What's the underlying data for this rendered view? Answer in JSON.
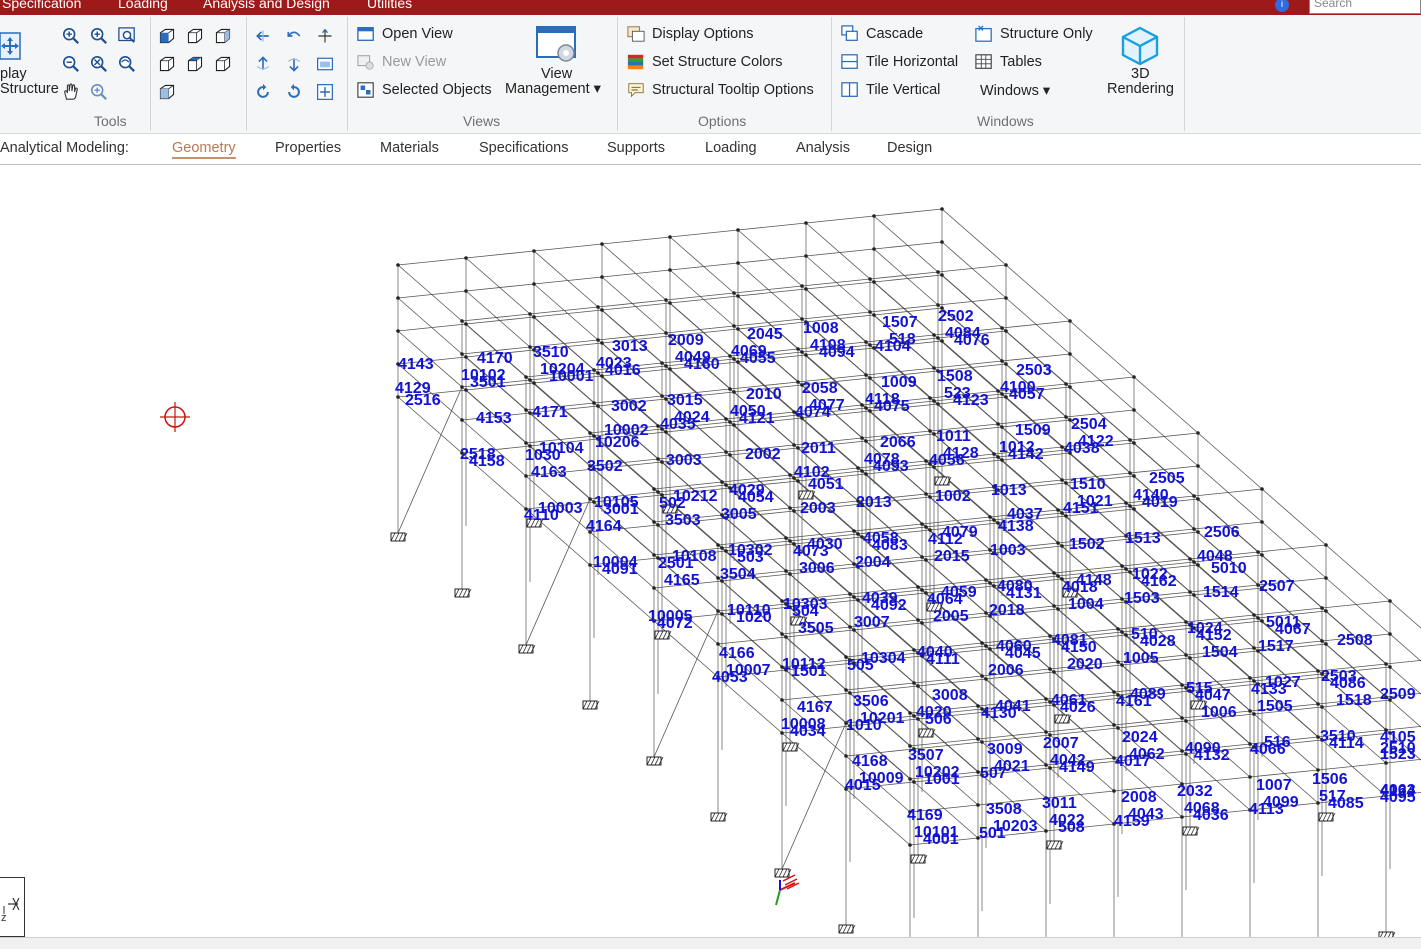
{
  "menu": {
    "items": [
      "Specification",
      "Loading",
      "Analysis and Design",
      "Utilities"
    ],
    "search_placeholder": "Search",
    "info_label": "i"
  },
  "ribbon": {
    "display_structure": {
      "line1": "play",
      "line2": "Structure"
    },
    "groups": {
      "tools": "Tools",
      "views": "Views",
      "options": "Options",
      "windows": "Windows"
    },
    "views": {
      "open_view": "Open View",
      "new_view": "New View",
      "selected_objects": "Selected Objects",
      "view_management_1": "View",
      "view_management_2": "Management ▾"
    },
    "options": {
      "display_options": "Display Options",
      "set_structure_colors": "Set Structure Colors",
      "structural_tooltip_options": "Structural Tooltip Options"
    },
    "windows": {
      "cascade": "Cascade",
      "tile_horizontal": "Tile Horizontal",
      "tile_vertical": "Tile Vertical",
      "structure_only": "Structure Only",
      "tables": "Tables",
      "windows_dropdown": "Windows ▾",
      "rendering_1": "3D",
      "rendering_2": "Rendering"
    }
  },
  "subtabs": {
    "label": "Analytical Modeling:",
    "items": [
      "Geometry",
      "Properties",
      "Materials",
      "Specifications",
      "Supports",
      "Loading",
      "Analysis",
      "Design"
    ],
    "active": "Geometry"
  },
  "model": {
    "colors": {
      "label": "#1212d6",
      "member": "#555555",
      "node": "#222222",
      "cursor": "#cc1111"
    },
    "labels": [
      "4129",
      "4158",
      "4110",
      "4091",
      "4072",
      "4053",
      "4034",
      "4015",
      "4001",
      "3501",
      "1030",
      "3001",
      "2501",
      "1020",
      "1501",
      "1010",
      "1001",
      "501",
      "10001",
      "10002",
      "502",
      "503",
      "504",
      "505",
      "506",
      "507",
      "508",
      "4016",
      "4035",
      "4054",
      "4073",
      "4092",
      "4111",
      "4130",
      "4149",
      "4159",
      "4160",
      "4121",
      "4102",
      "4083",
      "4064",
      "4045",
      "4026",
      "4017",
      "4036",
      "4055",
      "4074",
      "4093",
      "4112",
      "4131",
      "4150",
      "4161",
      "4132",
      "4113",
      "4094",
      "4075",
      "4056",
      "4037",
      "4018",
      "4028",
      "4047",
      "4066",
      "4085",
      "4104",
      "4123",
      "4142",
      "4151",
      "4162",
      "4152",
      "4133",
      "4114",
      "4095",
      "4076",
      "4057",
      "4038",
      "4019",
      "4048",
      "4067",
      "4086",
      "4105",
      "4124",
      "4143",
      "4153",
      "4163",
      "4164",
      "4165",
      "4166",
      "4167",
      "4168",
      "4169",
      "4170",
      "4171",
      "3502",
      "3503",
      "3504",
      "3505",
      "3506",
      "3507",
      "3508",
      "3510",
      "3002",
      "3003",
      "3005",
      "3006",
      "3007",
      "3008",
      "3009",
      "3011",
      "3013",
      "3015",
      "2002",
      "2003",
      "2004",
      "2005",
      "2006",
      "2007",
      "2008",
      "2009",
      "2010",
      "2011",
      "2013",
      "2015",
      "2018",
      "2020",
      "2024",
      "2032",
      "2045",
      "2058",
      "2066",
      "1002",
      "1003",
      "1004",
      "1005",
      "1006",
      "1007",
      "1008",
      "1009",
      "1011",
      "1013",
      "1502",
      "1503",
      "1504",
      "1505",
      "1506",
      "1507",
      "1508",
      "1509",
      "1510",
      "1513",
      "1514",
      "1517",
      "1518",
      "1523",
      "2502",
      "2503",
      "2504",
      "2505",
      "2506",
      "2507",
      "2508",
      "2509",
      "2510",
      "2516",
      "2518",
      "10003",
      "10004",
      "10005",
      "10007",
      "10008",
      "10009",
      "10101",
      "10102",
      "10104",
      "10105",
      "10108",
      "10110",
      "10112",
      "10201",
      "10202",
      "10203",
      "10204",
      "10206",
      "10212",
      "10302",
      "10303",
      "10304",
      "4020",
      "4021",
      "4022",
      "4023",
      "4024",
      "4029",
      "4030",
      "4039",
      "4040",
      "4041",
      "4042",
      "4043",
      "4049",
      "4050",
      "4051",
      "4058",
      "4059",
      "4060",
      "4061",
      "4062",
      "4068",
      "4069",
      "4077",
      "4078",
      "4079",
      "4080",
      "4081",
      "4089",
      "4090",
      "4099",
      "4108",
      "4118",
      "4128",
      "4138",
      "4148",
      "510",
      "515",
      "516",
      "517",
      "518",
      "523",
      "1012",
      "1021",
      "1022",
      "1024",
      "1027",
      "3510",
      "4063",
      "4084",
      "4100",
      "4122",
      "4140",
      "5010",
      "5011",
      "2503"
    ]
  }
}
